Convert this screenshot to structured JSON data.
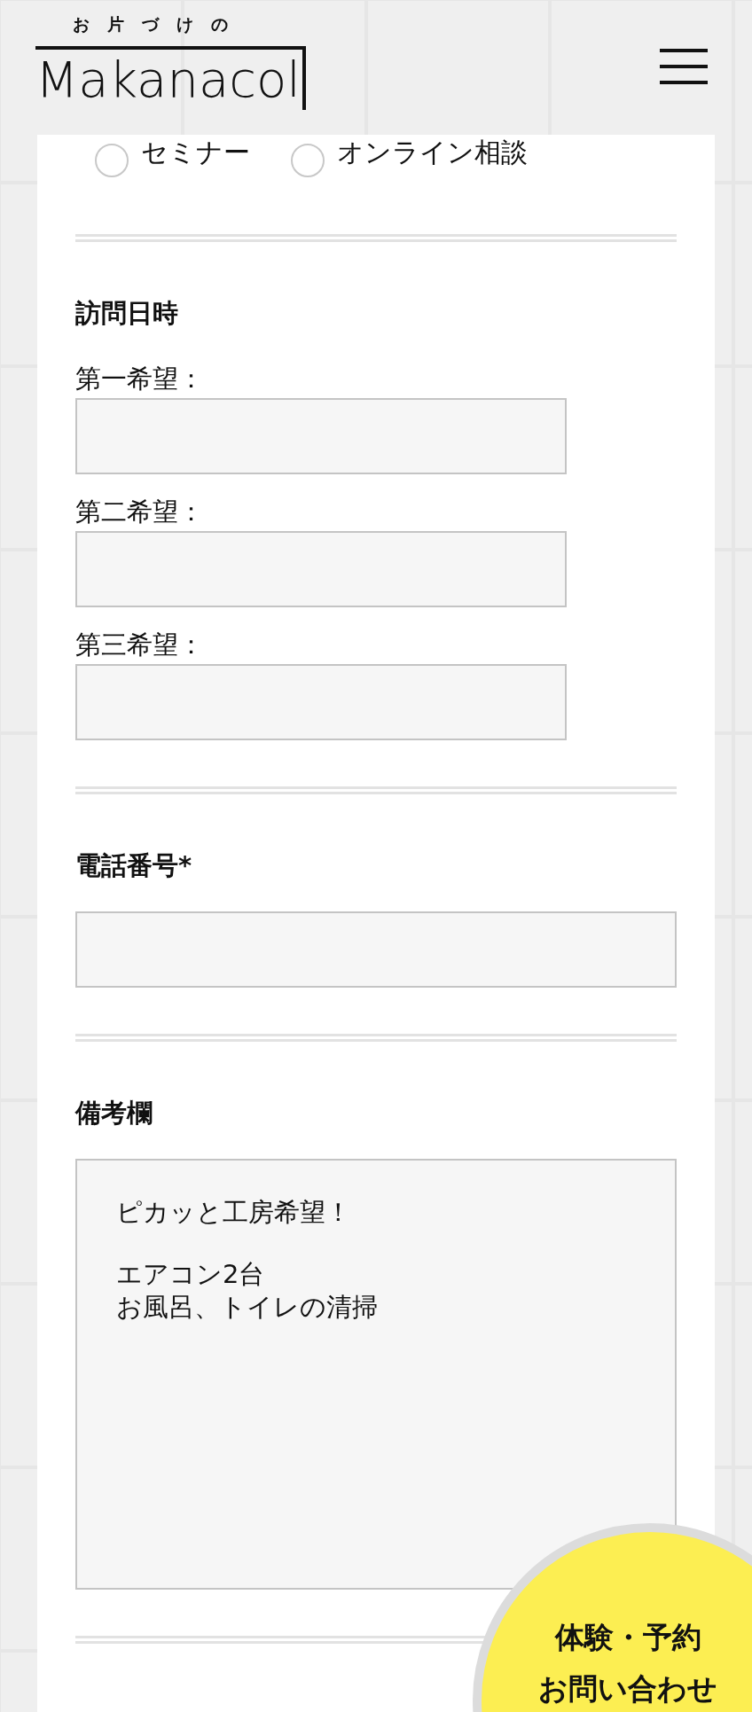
{
  "header": {
    "logo": {
      "tagline": "お片づけの",
      "name": "Makanacol"
    }
  },
  "consult_options": [
    {
      "label": "セミナー",
      "selected": false
    },
    {
      "label": "オンライン相談",
      "selected": false
    }
  ],
  "visit_datetime": {
    "title": "訪問日時",
    "choices": [
      {
        "label": "第一希望："
      },
      {
        "label": "第二希望："
      },
      {
        "label": "第三希望："
      }
    ]
  },
  "phone": {
    "title": "電話番号*"
  },
  "notes": {
    "title": "備考欄",
    "paragraphs": [
      [
        "ピカッと工房希望！"
      ],
      [
        "エアコン2台",
        "お風呂、トイレの清掃"
      ]
    ]
  },
  "floating_badge": {
    "lines": [
      "体験・予約",
      "お問い合わせ"
    ]
  }
}
